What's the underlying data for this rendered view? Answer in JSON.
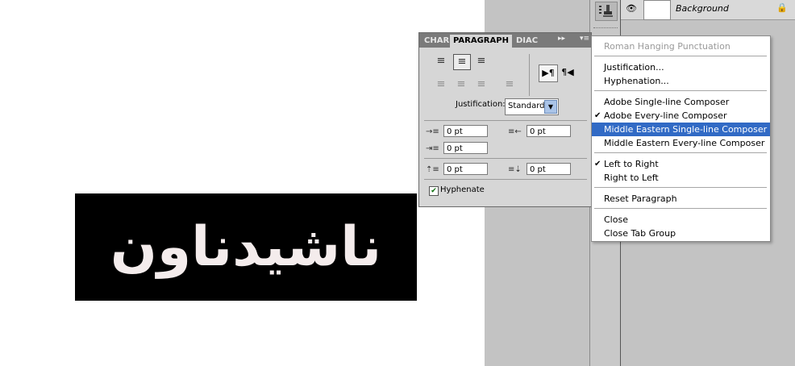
{
  "canvas": {
    "text": "ناشیدناون"
  },
  "layers": {
    "name": "Background"
  },
  "panel": {
    "tabs": [
      "CHAR",
      "PARAGRAPH",
      "DIAC"
    ],
    "justification_label": "Justification:",
    "justification_value": "Standard",
    "fields": {
      "indent_left": "0 pt",
      "indent_right": "0 pt",
      "indent_first": "0 pt",
      "space_before": "0 pt",
      "space_after": "0 pt"
    },
    "hyphenate_label": "Hyphenate",
    "hyphenate_checked": true
  },
  "menu": {
    "items": [
      {
        "label": "Roman Hanging Punctuation",
        "disabled": true
      },
      {
        "label": "Justification..."
      },
      {
        "label": "Hyphenation..."
      },
      {
        "label": "Adobe Single-line Composer"
      },
      {
        "label": "Adobe Every-line Composer",
        "checked": true
      },
      {
        "label": "Middle Eastern Single-line Composer",
        "highlighted": true
      },
      {
        "label": "Middle Eastern Every-line Composer"
      },
      {
        "label": "Left to Right",
        "checked": true
      },
      {
        "label": "Right to Left"
      },
      {
        "label": "Reset Paragraph"
      },
      {
        "label": "Close"
      },
      {
        "label": "Close Tab Group"
      }
    ]
  },
  "colors": {
    "highlight": "#316ac5",
    "canvas_bg": "#ffffff",
    "text_layer_bg": "#000000"
  }
}
